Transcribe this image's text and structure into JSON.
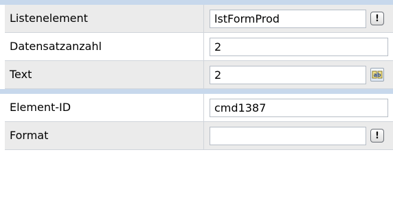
{
  "properties": [
    {
      "label": "Listenelement",
      "value": "lstFormProd",
      "button": "!"
    },
    {
      "label": "Datensatzanzahl",
      "value": "2"
    },
    {
      "label": "Text",
      "value": "2",
      "button_icon": "text-builder-icon"
    },
    {
      "label": "Element-ID",
      "value": "cmd1387"
    },
    {
      "label": "Format",
      "value": "",
      "button": "!"
    }
  ],
  "colors": {
    "separator": "#c7d8ec",
    "row_alt": "#ebebeb",
    "row_plain": "#ffffff",
    "grid_line": "#d0d4da"
  }
}
